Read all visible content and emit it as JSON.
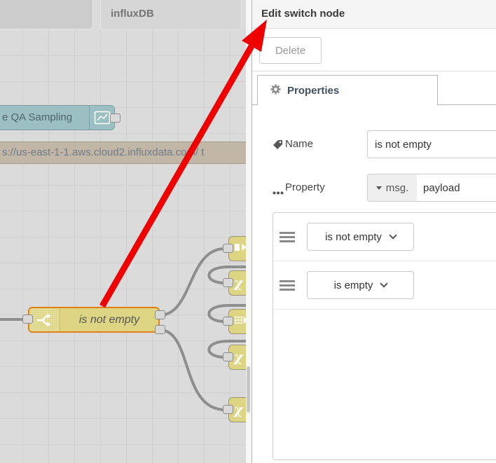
{
  "workspace": {
    "tabs": [
      {
        "label": ""
      },
      {
        "label": "influxDB"
      }
    ],
    "nodes": {
      "chart": {
        "label": "e QA Sampling"
      },
      "http_request": {
        "label": "s://us-east-1-1.aws.cloud2.influxdata.com/ t"
      },
      "switch": {
        "label": "is not empty"
      },
      "small_nodes": [
        {
          "icon": "join-icon",
          "glyph": ""
        },
        {
          "icon": "chi-icon",
          "glyph": "χ"
        },
        {
          "icon": "split-icon",
          "glyph": ""
        },
        {
          "icon": "chi-icon",
          "glyph": "χ"
        },
        {
          "icon": "chi-icon",
          "glyph": "χ"
        }
      ]
    }
  },
  "panel": {
    "title": "Edit switch node",
    "delete_button": "Delete",
    "properties_tab": "Properties",
    "form": {
      "name_label": "Name",
      "name_value": "is not empty",
      "property_label": "Property",
      "property_prefix": "msg.",
      "property_value": "payload",
      "rules": [
        {
          "operator": "is not empty"
        },
        {
          "operator": "is empty"
        }
      ]
    }
  },
  "colors": {
    "switch_node": "#ddd584",
    "selected_border": "#de8016",
    "chart_node": "#9bbfc2",
    "http_node": "#c2b6a6",
    "wire": "#8e8e8e",
    "arrow": "#ef0000"
  }
}
